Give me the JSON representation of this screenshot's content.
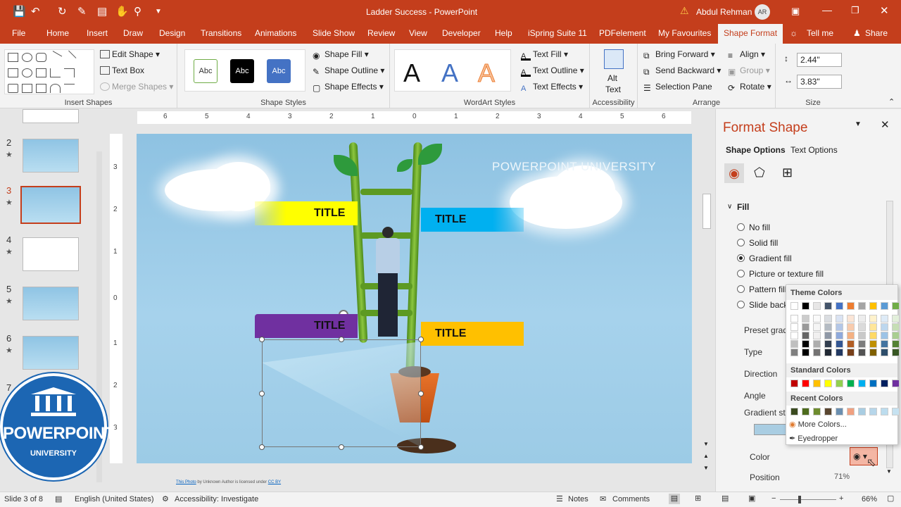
{
  "titlebar": {
    "doc_title": "Ladder Success - PowerPoint",
    "user_name": "Abdul Rehman",
    "user_initials": "AR"
  },
  "tabs": [
    "File",
    "Home",
    "Insert",
    "Draw",
    "Design",
    "Transitions",
    "Animations",
    "Slide Show",
    "Review",
    "View",
    "Developer",
    "Help",
    "iSpring Suite 11",
    "PDFelement",
    "My Favourites",
    "Shape Format"
  ],
  "tab_tellme": "Tell me",
  "tab_share": "Share",
  "ribbon": {
    "insert_shapes": {
      "label": "Insert Shapes",
      "edit_shape": "Edit Shape",
      "text_box": "Text Box",
      "merge_shapes": "Merge Shapes"
    },
    "shape_styles": {
      "label": "Shape Styles",
      "samples": [
        "Abc",
        "Abc",
        "Abc"
      ],
      "shape_fill": "Shape Fill",
      "shape_outline": "Shape Outline",
      "shape_effects": "Shape Effects"
    },
    "wordart": {
      "label": "WordArt Styles",
      "letters": [
        "A",
        "A",
        "A"
      ],
      "text_fill": "Text Fill",
      "text_outline": "Text Outline",
      "text_effects": "Text Effects"
    },
    "accessibility": {
      "label": "Accessibility",
      "alt_text_1": "Alt",
      "alt_text_2": "Text"
    },
    "arrange": {
      "label": "Arrange",
      "bring_forward": "Bring Forward",
      "send_backward": "Send Backward",
      "selection_pane": "Selection Pane",
      "align": "Align",
      "group": "Group",
      "rotate": "Rotate"
    },
    "size": {
      "label": "Size",
      "height": "2.44\"",
      "width": "3.83\""
    }
  },
  "ruler": {
    "h": [
      "6",
      "5",
      "4",
      "3",
      "2",
      "1",
      "0",
      "1",
      "2",
      "3",
      "4",
      "5",
      "6"
    ],
    "v": [
      "3",
      "2",
      "1",
      "0",
      "1",
      "2",
      "3"
    ]
  },
  "thumbs": {
    "numbers": [
      "2",
      "3",
      "4",
      "5",
      "6",
      "7"
    ],
    "star": "★"
  },
  "slide": {
    "watermark": "POWERPOINT UNIVERSITY",
    "titles": [
      "TITLE",
      "TITLE",
      "TITLE",
      "TITLE"
    ],
    "credit_link": "This Photo",
    "credit_mid": " by Unknown Author is licensed under ",
    "credit_license": "CC BY",
    "colors": {
      "yellow": "#ffff00",
      "blue": "#00b0f0",
      "purple": "#7030a0",
      "orange": "#ffc000"
    }
  },
  "format_pane": {
    "title": "Format Shape",
    "tab_shape": "Shape Options",
    "tab_text": "Text Options",
    "section": "Fill",
    "options": [
      "No fill",
      "Solid fill",
      "Gradient fill",
      "Picture or texture fill",
      "Pattern fill",
      "Slide backg"
    ],
    "labels": [
      "Preset gradi",
      "Type",
      "Direction",
      "Angle",
      "Gradient sto",
      "Color",
      "Position"
    ],
    "position_value": "71%"
  },
  "picker": {
    "theme": "Theme Colors",
    "standard": "Standard Colors",
    "recent": "Recent Colors",
    "more": "More Colors...",
    "eyedropper": "Eyedropper",
    "theme_row": [
      "#ffffff",
      "#000000",
      "#e7e6e6",
      "#44546a",
      "#4472c4",
      "#ed7d31",
      "#a5a5a5",
      "#ffc000",
      "#5b9bd5",
      "#70ad47"
    ],
    "standard_row": [
      "#c00000",
      "#ff0000",
      "#ffc000",
      "#ffff00",
      "#92d050",
      "#00b050",
      "#00b0f0",
      "#0070c0",
      "#002060",
      "#7030a0"
    ],
    "recent_row": [
      "#3a4a1f",
      "#4d6b1d",
      "#6e8c2e",
      "#5a4630",
      "#6b8fb0",
      "#f0a080",
      "#a9cde2",
      "#b6d6ea",
      "#bcdcee",
      "#c6e2f1"
    ]
  },
  "status": {
    "slide": "Slide 3 of 8",
    "language": "English (United States)",
    "accessibility": "Accessibility: Investigate",
    "notes": "Notes",
    "comments": "Comments",
    "zoom": "66%"
  },
  "logo": {
    "text": "POWERPOINT",
    "sub": "UNIVERSITY"
  }
}
